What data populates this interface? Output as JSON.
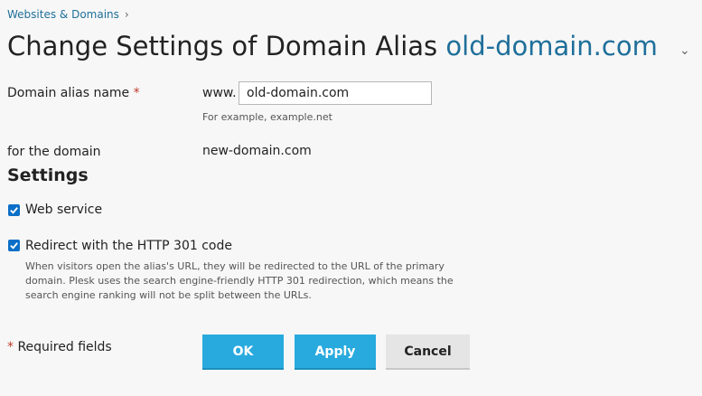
{
  "breadcrumb": {
    "label": "Websites & Domains",
    "separator": "›"
  },
  "title": {
    "prefix": "Change Settings of Domain Alias ",
    "domain": "old-domain.com",
    "chevron": "⌄"
  },
  "alias": {
    "label": "Domain alias name",
    "required_mark": "*",
    "prefix": "www.",
    "value": "old-domain.com",
    "hint": "For example, example.net"
  },
  "for_domain": {
    "label": "for the domain",
    "value": "new-domain.com"
  },
  "settings": {
    "title": "Settings",
    "web_service": {
      "label": "Web service",
      "checked": true
    },
    "redirect": {
      "label": "Redirect with the HTTP 301 code",
      "checked": true,
      "description": "When visitors open the alias's URL, they will be redirected to the URL of the primary domain. Plesk uses the search engine-friendly HTTP 301 redirection, which means the search engine ranking will not be split between the URLs."
    }
  },
  "footer": {
    "required_mark": "*",
    "required_text": " Required fields"
  },
  "buttons": {
    "ok": "OK",
    "apply": "Apply",
    "cancel": "Cancel"
  },
  "colors": {
    "accent": "#1f6f9a",
    "button_primary": "#28aade",
    "checkbox": "#0b6fc7",
    "required": "#c0392b"
  }
}
